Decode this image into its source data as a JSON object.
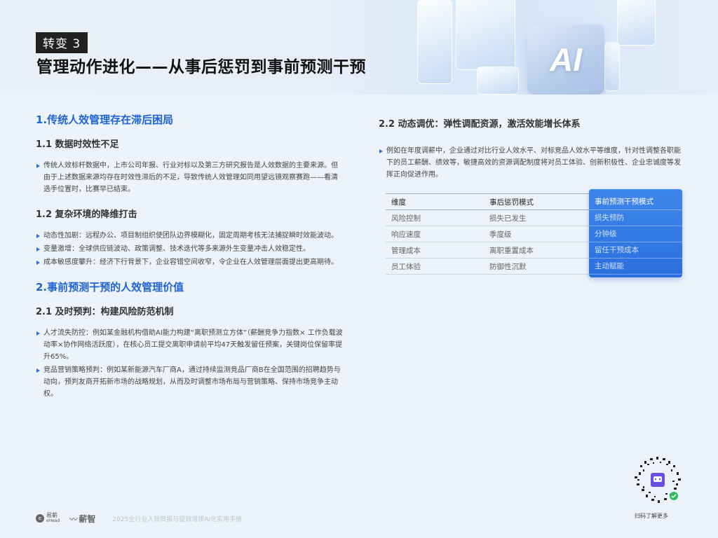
{
  "header": {
    "tag": "转变 3",
    "title": "管理动作进化——从事后惩罚到事前预测干预",
    "ai_badge": "AI"
  },
  "left": {
    "s1_title": "1.传统人效管理存在滞后困局",
    "s1_1_title": "1.1 数据时效性不足",
    "s1_1_bullets": [
      "传统人效标杆数据中，上市公司年报、行业对标以及第三方研究报告是人效数据的主要来源。但由于上述数据来源均存在时效性滞后的不足，导致传统人效管理如同用望远镜观察赛跑——看清选手位置时，比赛早已结束。"
    ],
    "s1_2_title": "1.2 复杂环境的降维打击",
    "s1_2_bullets": [
      "动态性加剧：远程办公、项目制组织使团队边界模糊化，固定周期考核无法捕捉瞬时效能波动。",
      "变量激增：全球供应链波动、政策调整、技术迭代等多来源外生变量冲击人效稳定性。",
      "成本敏感度攀升：经济下行背景下，企业容错空间收窄，令企业在人效管理层面提出更高期待。"
    ],
    "s2_title": "2.事前预测干预的人效管理价值",
    "s2_1_title": "2.1 及时预判：构建风险防范机制",
    "s2_1_bullets": [
      "人才流失防控：例如某金融机构借助AI能力构建“离职预测立方体”（薪酬竞争力指数× 工作负载波动率×协作网络活跃度），在核心员工提交离职申请前平均47天触发留任预案，关键岗位保留率提升65%。",
      "竞品营销策略预判：例如某新能源汽车厂商A，通过持续监测竞品厂商B在全国范围的招聘趋势与动向，预判友商开拓新市场的战略规划，从而及时调整市场布局与营销策略、保持市场竞争主动权。"
    ]
  },
  "right": {
    "s2_2_title": "2.2 动态调优：弹性调配资源，激活效能增长体系",
    "s2_2_bullets": [
      "例如在年度调薪中，企业通过对比行业人效水平、对标竞品人效水平等维度，针对性调整各职能下的员工薪酬、绩效等，敏捷高效的资源调配制度将对员工体验、创新积极性、企业忠诚度等发挥正向促进作用。"
    ],
    "table": {
      "headers": [
        "维度",
        "事后惩罚模式",
        "事前预测干预模式"
      ],
      "rows": [
        [
          "风险控制",
          "损失已发生",
          "损失预防"
        ],
        [
          "响应速度",
          "季度级",
          "分钟级"
        ],
        [
          "管理成本",
          "离职重置成本",
          "留任干预成本"
        ],
        [
          "员工体验",
          "防御性沉默",
          "主动赋能"
        ]
      ]
    }
  },
  "footer": {
    "logo1_cn": "易薪",
    "logo1_en": "eHead",
    "logo2": "薪智",
    "doc_title": "2025全行业人效简报与提效增质AI化实用手册",
    "qr_caption": "扫码了解更多"
  },
  "colors": {
    "accent": "#1f63d6",
    "highlight_column": "#2a6fde",
    "tag_bg": "#222222"
  }
}
